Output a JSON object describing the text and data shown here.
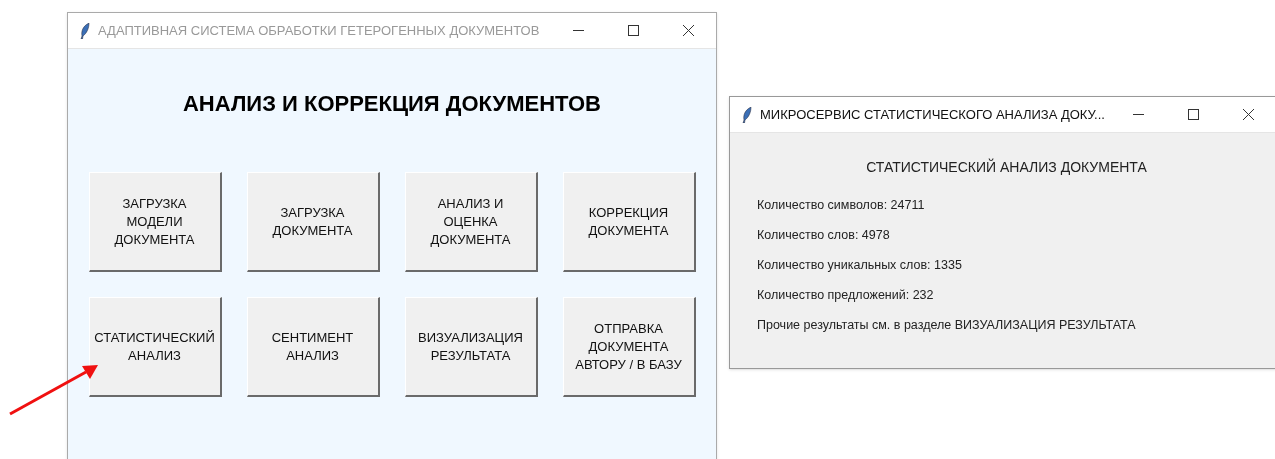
{
  "main_window": {
    "title": "АДАПТИВНАЯ СИСТЕМА ОБРАБОТКИ ГЕТЕРОГЕННЫХ ДОКУМЕНТОВ",
    "heading": "АНАЛИЗ И КОРРЕКЦИЯ ДОКУМЕНТОВ",
    "buttons": [
      {
        "lines": [
          "ЗАГРУЗКА",
          "МОДЕЛИ",
          "ДОКУМЕНТА"
        ]
      },
      {
        "lines": [
          "ЗАГРУЗКА",
          "ДОКУМЕНТА"
        ]
      },
      {
        "lines": [
          "АНАЛИЗ И",
          "ОЦЕНКА",
          "ДОКУМЕНТА"
        ]
      },
      {
        "lines": [
          "КОРРЕКЦИЯ",
          "ДОКУМЕНТА"
        ]
      },
      {
        "lines": [
          "СТАТИСТИЧЕСКИЙ",
          "АНАЛИЗ"
        ]
      },
      {
        "lines": [
          "СЕНТИМЕНТ",
          "АНАЛИЗ"
        ]
      },
      {
        "lines": [
          "ВИЗУАЛИЗАЦИЯ",
          "РЕЗУЛЬТАТА"
        ]
      },
      {
        "lines": [
          "ОТПРАВКА",
          "ДОКУМЕНТА",
          "АВТОРУ / В БАЗУ"
        ]
      }
    ]
  },
  "stats_window": {
    "title": "МИКРОСЕРВИС СТАТИСТИЧЕСКОГО АНАЛИЗА ДОКУ...",
    "heading": "СТАТИСТИЧЕСКИЙ АНАЛИЗ ДОКУМЕНТА",
    "lines": [
      "Количество символов: 24711",
      "Количество слов: 4978",
      "Количество уникальных слов: 1335",
      "Количество предложений: 232",
      "Прочие результаты см. в разделе ВИЗУАЛИЗАЦИЯ РЕЗУЛЬТАТА"
    ]
  }
}
